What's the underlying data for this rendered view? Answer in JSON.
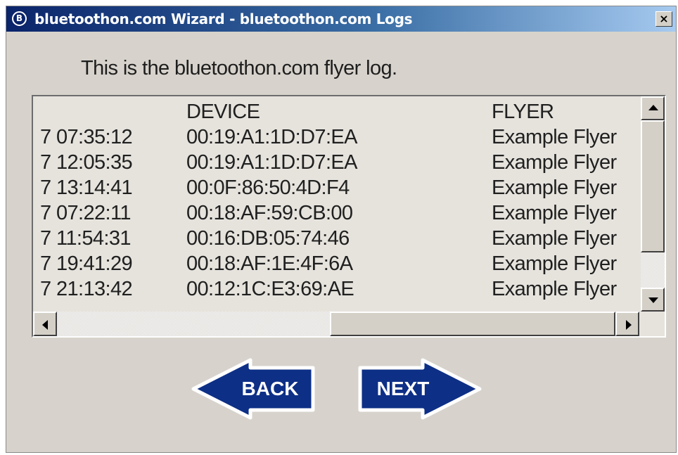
{
  "window": {
    "title": "bluetoothon.com Wizard - bluetoothon.com Logs",
    "icon": "bluetoothon-logo-icon",
    "icon_letter": "B",
    "close_label": "×"
  },
  "intro_text": "This is the bluetoothon.com flyer log.",
  "log": {
    "columns": [
      "",
      "DEVICE",
      "FLYER"
    ],
    "rows": [
      {
        "time": "7 07:35:12",
        "device": "00:19:A1:1D:D7:EA",
        "flyer": "Example Flyer"
      },
      {
        "time": "7 12:05:35",
        "device": "00:19:A1:1D:D7:EA",
        "flyer": "Example Flyer"
      },
      {
        "time": "7 13:14:41",
        "device": "00:0F:86:50:4D:F4",
        "flyer": "Example Flyer"
      },
      {
        "time": "7 07:22:11",
        "device": "00:18:AF:59:CB:00",
        "flyer": "Example Flyer"
      },
      {
        "time": "7 11:54:31",
        "device": "00:16:DB:05:74:46",
        "flyer": "Example Flyer"
      },
      {
        "time": "7 19:41:29",
        "device": "00:18:AF:1E:4F:6A",
        "flyer": "Example Flyer"
      },
      {
        "time": "7 21:13:42",
        "device": "00:12:1C:E3:69:AE",
        "flyer": "Example Flyer"
      }
    ]
  },
  "scrollbars": {
    "vertical_position": 0.0,
    "horizontal_position": 0.0
  },
  "buttons": {
    "back_label": "BACK",
    "next_label": "NEXT"
  },
  "colors": {
    "title_bar": "#0a246a",
    "dialog_bg": "#d7d3cc",
    "nav_button": "#0d2f86"
  }
}
